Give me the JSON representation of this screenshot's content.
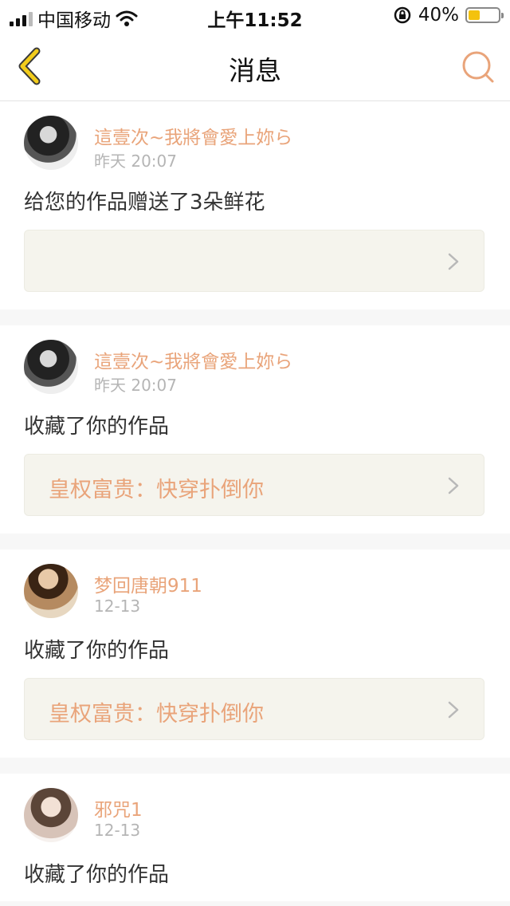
{
  "status_bar": {
    "carrier": "中国移动",
    "time": "上午11:52",
    "battery_percent": "40%",
    "battery_level": 0.4,
    "icons": [
      "signal-icon",
      "wifi-icon",
      "rotation-lock-icon",
      "battery-icon"
    ]
  },
  "nav": {
    "title": "消息",
    "back_icon": "back-chevron-icon",
    "search_icon": "search-icon"
  },
  "colors": {
    "accent": "#e9a47a",
    "back_icon": "#f2cc1b",
    "work_card_bg": "#f5f4ed"
  },
  "messages": [
    {
      "user": "這壹次~我將會愛上妳ら",
      "time": "昨天 20:07",
      "action": "给您的作品赠送了3朵鲜花",
      "work_title": ""
    },
    {
      "user": "這壹次~我將會愛上妳ら",
      "time": "昨天 20:07",
      "action": "收藏了你的作品",
      "work_title": "皇权富贵：快穿扑倒你"
    },
    {
      "user": "梦回唐朝911",
      "time": "12-13",
      "action": "收藏了你的作品",
      "work_title": "皇权富贵：快穿扑倒你"
    },
    {
      "user": "邪咒1",
      "time": "12-13",
      "action": "收藏了你的作品"
    }
  ]
}
